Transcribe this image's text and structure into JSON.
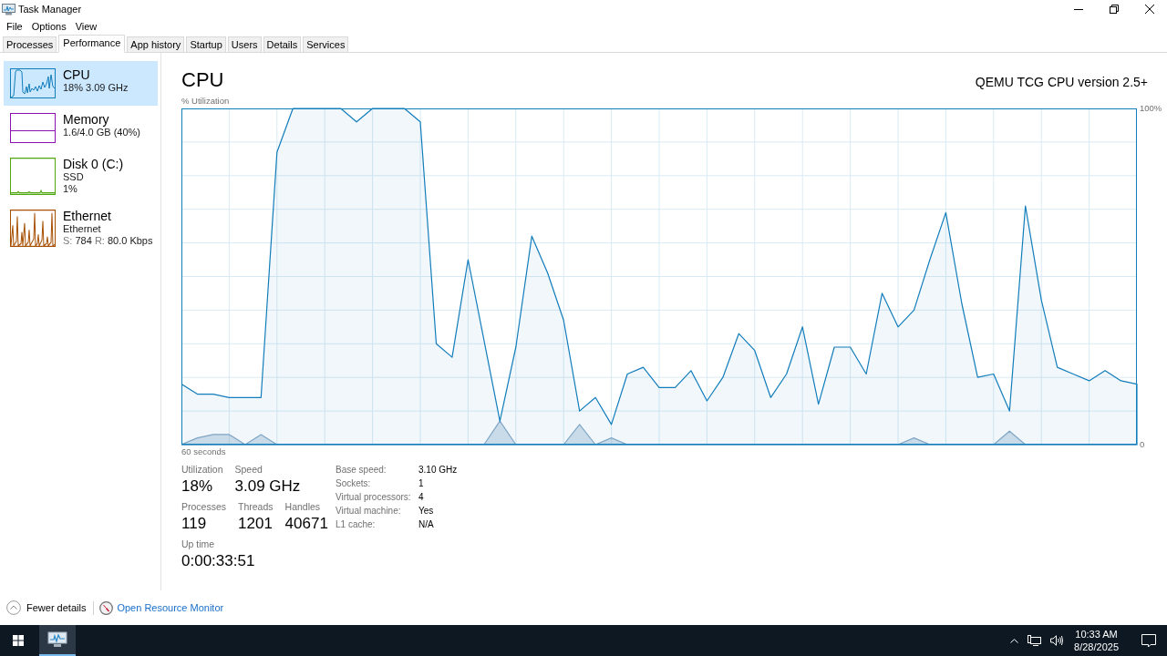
{
  "window": {
    "title": "Task Manager"
  },
  "menu": [
    "File",
    "Options",
    "View"
  ],
  "tabs": [
    {
      "label": "Processes",
      "selected": false
    },
    {
      "label": "Performance",
      "selected": true
    },
    {
      "label": "App history",
      "selected": false
    },
    {
      "label": "Startup",
      "selected": false
    },
    {
      "label": "Users",
      "selected": false
    },
    {
      "label": "Details",
      "selected": false
    },
    {
      "label": "Services",
      "selected": false
    }
  ],
  "sidebar": {
    "items": [
      {
        "kind": "cpu",
        "title": "CPU",
        "lines": [
          "18% 3.09 GHz"
        ],
        "selected": true,
        "color": "#117dbb"
      },
      {
        "kind": "memory",
        "title": "Memory",
        "lines": [
          "1.6/4.0 GB (40%)"
        ],
        "selected": false,
        "color": "#8b12ae"
      },
      {
        "kind": "disk",
        "title": "Disk 0 (C:)",
        "lines": [
          "SSD",
          "1%"
        ],
        "selected": false,
        "color": "#4da60c"
      },
      {
        "kind": "network",
        "title": "Ethernet",
        "lines": [
          "Ethernet"
        ],
        "rates": [
          {
            "label": "S:",
            "value": "784"
          },
          {
            "label": "R:",
            "value": "80.0 Kbps"
          }
        ],
        "selected": false,
        "color": "#a74f01"
      }
    ]
  },
  "performance": {
    "title": "CPU",
    "device": "QEMU TCG CPU version 2.5+",
    "chart_data": [
      {
        "type": "area",
        "ylabel": "% Utilization",
        "xlabel": "60 seconds",
        "categories": [
          null,
          null,
          null,
          null,
          null,
          null,
          null,
          null,
          null,
          null,
          null,
          null,
          null,
          null,
          null,
          null,
          null,
          null,
          null,
          null,
          null,
          null,
          null,
          null,
          null,
          null,
          null,
          null,
          null,
          null,
          null,
          null,
          null,
          null,
          null,
          null,
          null,
          null,
          null,
          null,
          null,
          null,
          null,
          null,
          null,
          null,
          null,
          null,
          null,
          null,
          null,
          null,
          null,
          null,
          null,
          null,
          null,
          null,
          null,
          null,
          null
        ],
        "ylim": [
          0,
          100
        ],
        "yticks": [
          {
            "value": 100,
            "label": "100%"
          },
          {
            "value": 0,
            "label": "0"
          }
        ],
        "grid": true,
        "series": [
          {
            "color": "#117dbb",
            "values": [
              18,
              15,
              15,
              14,
              14,
              14,
              87,
              100,
              100,
              100,
              100,
              96,
              100,
              100,
              100,
              96,
              30,
              26,
              55,
              31,
              7,
              29,
              62,
              51,
              37,
              10,
              14,
              6,
              21,
              23,
              17,
              17,
              22,
              13,
              20,
              33,
              28,
              14,
              21,
              35,
              12,
              29,
              29,
              21,
              45,
              35,
              40,
              55,
              69,
              42,
              20,
              21,
              10,
              71,
              43,
              23,
              21,
              19,
              22,
              19,
              18
            ]
          },
          {
            "color": "#86a9c6",
            "values": [
              0,
              2,
              3,
              3,
              0,
              3,
              0,
              0,
              0,
              0,
              0,
              0,
              0,
              0,
              0,
              0,
              0,
              0,
              0,
              0,
              7,
              0,
              0,
              0,
              0,
              6,
              0,
              2,
              0,
              0,
              0,
              0,
              0,
              0,
              0,
              0,
              0,
              0,
              0,
              0,
              0,
              0,
              0,
              0,
              0,
              0,
              2,
              0,
              0,
              0,
              0,
              0,
              4,
              0,
              0,
              0,
              0,
              0,
              0,
              0,
              0
            ]
          }
        ]
      }
    ],
    "stat_rows": [
      [
        {
          "label": "Utilization",
          "value": "18%"
        },
        {
          "label": "Speed",
          "value": "3.09 GHz"
        }
      ],
      [
        {
          "label": "Processes",
          "value": "119"
        },
        {
          "label": "Threads",
          "value": "1201"
        },
        {
          "label": "Handles",
          "value": "40671"
        }
      ],
      [
        {
          "label": "Up time",
          "value": "0:00:33:51"
        }
      ]
    ],
    "details": [
      {
        "label": "Base speed:",
        "value": "3.10 GHz"
      },
      {
        "label": "Sockets:",
        "value": "1"
      },
      {
        "label": "Virtual processors:",
        "value": "4"
      },
      {
        "label": "Virtual machine:",
        "value": "Yes"
      },
      {
        "label": "L1 cache:",
        "value": "N/A"
      }
    ]
  },
  "footer": {
    "fewer_details": "Fewer details",
    "resource_monitor_link": "Open Resource Monitor"
  },
  "taskbar": {
    "apps": [
      {
        "active": true
      }
    ],
    "clock": {
      "time": "10:33 AM",
      "date": "8/28/2025"
    }
  }
}
